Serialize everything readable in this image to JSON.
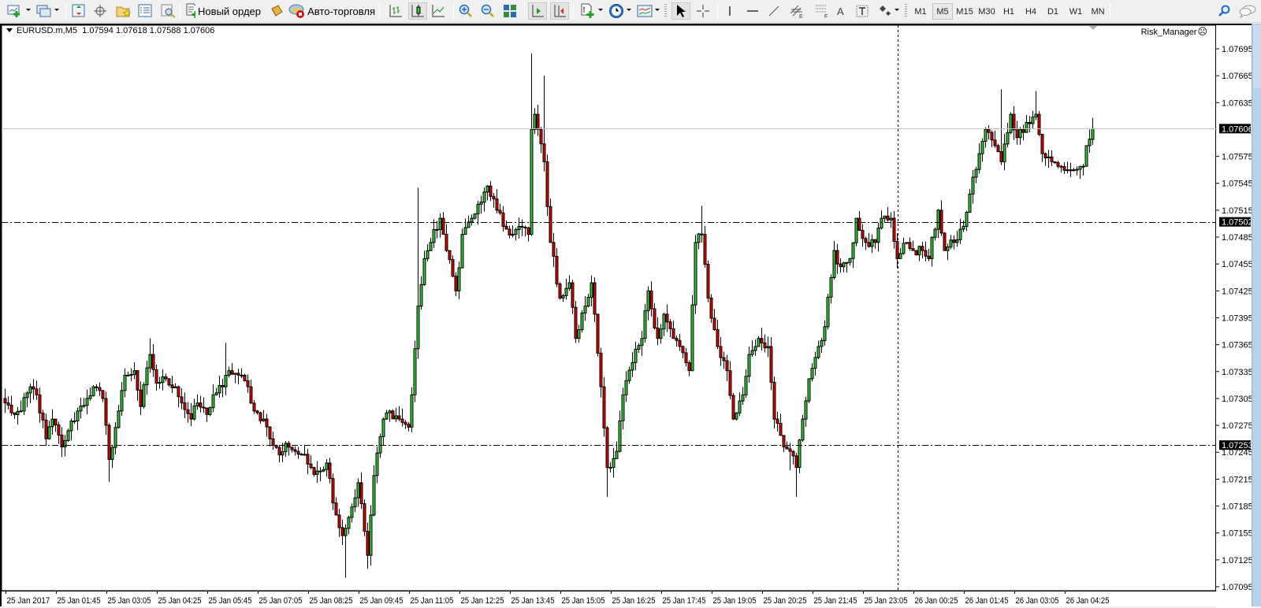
{
  "toolbar": {
    "new_order_label": "Новый ордер",
    "autotrading_label": "Авто-торговля",
    "periods": [
      "M1",
      "M5",
      "M15",
      "M30",
      "H1",
      "H4",
      "D1",
      "W1",
      "MN"
    ],
    "active_period": "M5"
  },
  "chart": {
    "symbol_header": "EURUSD.m,M5",
    "ohlc_header": "1.07594 1.07618 1.07588 1.07606",
    "indicator_label": "Risk_Manager",
    "indicator_status_icon": "☹"
  },
  "chart_data": {
    "type": "candlestick",
    "symbol": "EURUSD.m",
    "timeframe": "M5",
    "ylim": [
      1.07082,
      1.07705
    ],
    "y_ticks": [
      "1.07695",
      "1.07665",
      "1.07635",
      "1.07575",
      "1.07545",
      "1.07515",
      "1.07485",
      "1.07455",
      "1.07425",
      "1.07395",
      "1.07365",
      "1.07335",
      "1.07305",
      "1.07275",
      "1.07245",
      "1.07215",
      "1.07185",
      "1.07155",
      "1.07125",
      "1.07095"
    ],
    "x_ticks": [
      "25 Jan 2017",
      "25 Jan 01:45",
      "25 Jan 03:05",
      "25 Jan 04:25",
      "25 Jan 05:45",
      "25 Jan 07:05",
      "25 Jan 08:25",
      "25 Jan 09:45",
      "25 Jan 11:05",
      "25 Jan 12:25",
      "25 Jan 13:45",
      "25 Jan 15:05",
      "25 Jan 16:25",
      "25 Jan 17:45",
      "25 Jan 19:05",
      "25 Jan 20:25",
      "25 Jan 21:45",
      "25 Jan 23:05",
      "26 Jan 00:25",
      "26 Jan 01:45",
      "26 Jan 03:05",
      "26 Jan 04:25"
    ],
    "candle_count": 346,
    "close_anchors": [
      [
        0,
        1.073
      ],
      [
        3,
        1.07287
      ],
      [
        5,
        1.07291
      ],
      [
        8,
        1.07318
      ],
      [
        10,
        1.07309
      ],
      [
        13,
        1.0726
      ],
      [
        15,
        1.07282
      ],
      [
        18,
        1.07251
      ],
      [
        20,
        1.07269
      ],
      [
        23,
        1.07291
      ],
      [
        26,
        1.07305
      ],
      [
        28,
        1.07318
      ],
      [
        31,
        1.07305
      ],
      [
        33,
        1.07237
      ],
      [
        36,
        1.07291
      ],
      [
        38,
        1.07331
      ],
      [
        41,
        1.07336
      ],
      [
        43,
        1.07296
      ],
      [
        46,
        1.07354
      ],
      [
        48,
        1.07322
      ],
      [
        51,
        1.07327
      ],
      [
        54,
        1.07318
      ],
      [
        56,
        1.073
      ],
      [
        59,
        1.07282
      ],
      [
        61,
        1.073
      ],
      [
        64,
        1.07287
      ],
      [
        66,
        1.07309
      ],
      [
        69,
        1.07318
      ],
      [
        71,
        1.07336
      ],
      [
        74,
        1.07331
      ],
      [
        77,
        1.07318
      ],
      [
        79,
        1.07291
      ],
      [
        82,
        1.07282
      ],
      [
        84,
        1.0726
      ],
      [
        87,
        1.07242
      ],
      [
        89,
        1.07255
      ],
      [
        92,
        1.07246
      ],
      [
        94,
        1.07242
      ],
      [
        97,
        1.07228
      ],
      [
        99,
        1.07224
      ],
      [
        102,
        1.07233
      ],
      [
        105,
        1.07175
      ],
      [
        107,
        1.07152
      ],
      [
        110,
        1.07184
      ],
      [
        112,
        1.07211
      ],
      [
        115,
        1.0713
      ],
      [
        117,
        1.07219
      ],
      [
        120,
        1.07282
      ],
      [
        122,
        1.07291
      ],
      [
        125,
        1.07282
      ],
      [
        128,
        1.07273
      ],
      [
        129,
        1.07309
      ],
      [
        131,
        1.07408
      ],
      [
        133,
        1.07461
      ],
      [
        135,
        1.07479
      ],
      [
        138,
        1.07506
      ],
      [
        140,
        1.0747
      ],
      [
        143,
        1.07425
      ],
      [
        145,
        1.07488
      ],
      [
        148,
        1.07506
      ],
      [
        151,
        1.07524
      ],
      [
        153,
        1.07542
      ],
      [
        156,
        1.07515
      ],
      [
        158,
        1.07497
      ],
      [
        161,
        1.07488
      ],
      [
        163,
        1.07497
      ],
      [
        166,
        1.07488
      ],
      [
        167,
        1.07605
      ],
      [
        168,
        1.07622
      ],
      [
        171,
        1.07569
      ],
      [
        173,
        1.07479
      ],
      [
        176,
        1.07417
      ],
      [
        179,
        1.07434
      ],
      [
        181,
        1.07372
      ],
      [
        184,
        1.07408
      ],
      [
        186,
        1.07434
      ],
      [
        189,
        1.07318
      ],
      [
        191,
        1.07228
      ],
      [
        194,
        1.07246
      ],
      [
        196,
        1.07309
      ],
      [
        199,
        1.07345
      ],
      [
        202,
        1.07372
      ],
      [
        204,
        1.07425
      ],
      [
        207,
        1.07372
      ],
      [
        209,
        1.07399
      ],
      [
        212,
        1.07372
      ],
      [
        214,
        1.07363
      ],
      [
        217,
        1.07336
      ],
      [
        219,
        1.07479
      ],
      [
        221,
        1.07488
      ],
      [
        223,
        1.07417
      ],
      [
        226,
        1.07363
      ],
      [
        229,
        1.07336
      ],
      [
        231,
        1.07282
      ],
      [
        234,
        1.07309
      ],
      [
        236,
        1.07354
      ],
      [
        239,
        1.07372
      ],
      [
        242,
        1.07363
      ],
      [
        244,
        1.07282
      ],
      [
        247,
        1.07251
      ],
      [
        249,
        1.07246
      ],
      [
        251,
        1.07228
      ],
      [
        253,
        1.07282
      ],
      [
        255,
        1.07327
      ],
      [
        258,
        1.07363
      ],
      [
        260,
        1.07385
      ],
      [
        263,
        1.0747
      ],
      [
        265,
        1.07452
      ],
      [
        268,
        1.07461
      ],
      [
        270,
        1.07506
      ],
      [
        273,
        1.07479
      ],
      [
        276,
        1.07479
      ],
      [
        278,
        1.07506
      ],
      [
        281,
        1.07506
      ],
      [
        283,
        1.07461
      ],
      [
        286,
        1.07479
      ],
      [
        288,
        1.0747
      ],
      [
        291,
        1.0747
      ],
      [
        293,
        1.07461
      ],
      [
        296,
        1.07515
      ],
      [
        298,
        1.0747
      ],
      [
        301,
        1.07479
      ],
      [
        304,
        1.07497
      ],
      [
        306,
        1.07533
      ],
      [
        309,
        1.07578
      ],
      [
        311,
        1.07605
      ],
      [
        314,
        1.07587
      ],
      [
        316,
        1.07569
      ],
      [
        319,
        1.07622
      ],
      [
        321,
        1.07596
      ],
      [
        324,
        1.07613
      ],
      [
        327,
        1.07622
      ],
      [
        329,
        1.07578
      ],
      [
        332,
        1.07569
      ],
      [
        334,
        1.07564
      ],
      [
        337,
        1.0756
      ],
      [
        339,
        1.0756
      ],
      [
        342,
        1.07564
      ],
      [
        343,
        1.07587
      ],
      [
        345,
        1.07606
      ]
    ],
    "wick_extremes": [
      [
        167,
        1.0769
      ],
      [
        171,
        1.07665
      ],
      [
        221,
        1.0752
      ],
      [
        108,
        1.07105
      ],
      [
        115,
        1.07115
      ],
      [
        191,
        1.07195
      ],
      [
        251,
        1.07195
      ],
      [
        316,
        1.0765
      ],
      [
        327,
        1.07648
      ],
      [
        33,
        1.07212
      ],
      [
        46,
        1.07372
      ],
      [
        70,
        1.07367
      ],
      [
        131,
        1.0754
      ],
      [
        249,
        1.07225
      ]
    ],
    "last_candle": {
      "open": 1.07594,
      "high": 1.07618,
      "low": 1.07588,
      "close": 1.07606
    },
    "bid_line": "1.07606",
    "horizontal_lines": [
      "1.07502",
      "1.07253"
    ],
    "colors": {
      "bull": "#32cd32",
      "bear": "#e00000",
      "wick": "#000000",
      "bid_line": "#c0c0c0",
      "background": "#ffffff"
    }
  }
}
